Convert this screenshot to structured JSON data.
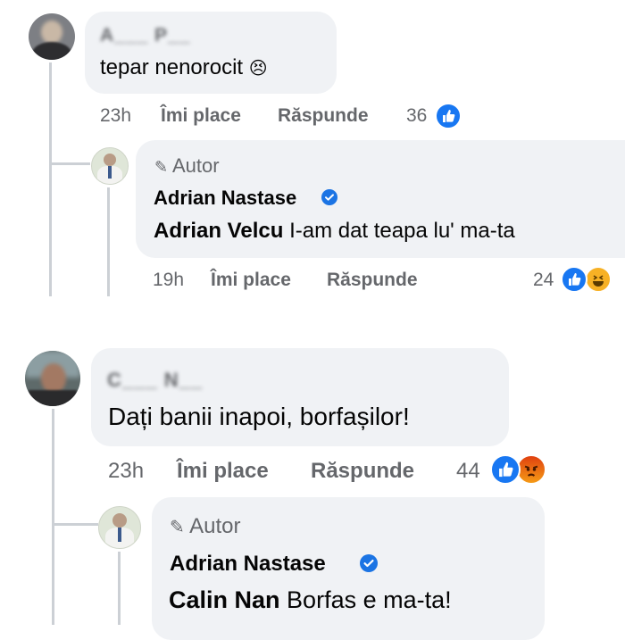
{
  "comments": [
    {
      "author_blurred": "A___ P__",
      "text": "tepar nenorocit",
      "emoji": "😣",
      "time": "23h",
      "like_label": "Îmi place",
      "reply_label": "Răspunde",
      "reaction_count": "36",
      "reactions": [
        "like-icon"
      ],
      "reply": {
        "tag": "Autor",
        "author": "Adrian Nastase",
        "mention": "Adrian Velcu",
        "text": "I-am dat teapa lu' ma-ta",
        "time": "19h",
        "like_label": "Îmi place",
        "reply_label": "Răspunde",
        "reaction_count": "24",
        "reactions": [
          "like-icon",
          "haha-icon"
        ]
      }
    },
    {
      "author_blurred": "C___ N__",
      "text": "Dați banii inapoi, borfașilor!",
      "time": "23h",
      "like_label": "Îmi place",
      "reply_label": "Răspunde",
      "reaction_count": "44",
      "reactions": [
        "like-icon",
        "angry-icon"
      ],
      "reply": {
        "tag": "Autor",
        "author": "Adrian Nastase",
        "mention": "Calin Nan",
        "text": "Borfas e ma-ta!"
      }
    }
  ],
  "colors": {
    "bubble": "#f0f2f5",
    "meta": "#65676b",
    "like_blue": "#1877f2",
    "verified_blue": "#1b74e4",
    "angry": "#e9710f",
    "haha": "#f7b125"
  }
}
